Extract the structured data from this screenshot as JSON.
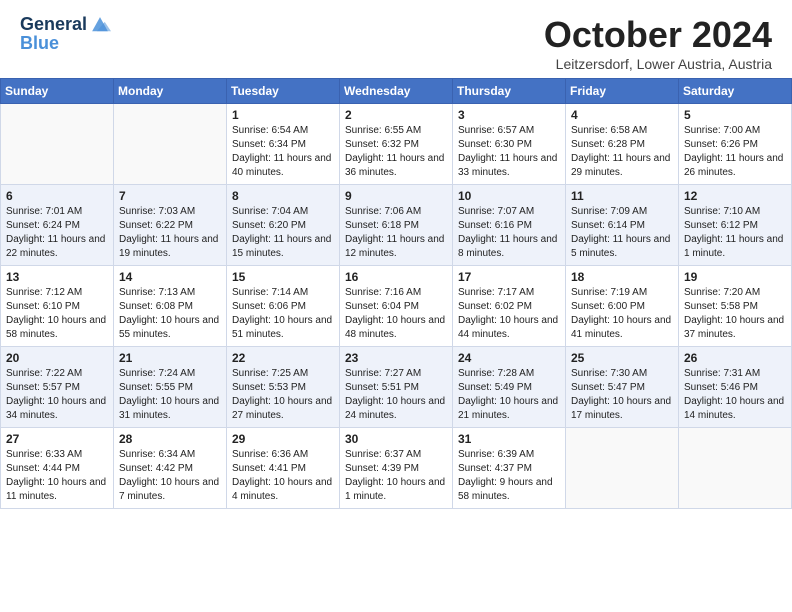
{
  "header": {
    "logo_line1": "General",
    "logo_line2": "Blue",
    "month": "October 2024",
    "location": "Leitzersdorf, Lower Austria, Austria"
  },
  "days_of_week": [
    "Sunday",
    "Monday",
    "Tuesday",
    "Wednesday",
    "Thursday",
    "Friday",
    "Saturday"
  ],
  "weeks": [
    [
      {
        "day": "",
        "info": ""
      },
      {
        "day": "",
        "info": ""
      },
      {
        "day": "1",
        "info": "Sunrise: 6:54 AM\nSunset: 6:34 PM\nDaylight: 11 hours and 40 minutes."
      },
      {
        "day": "2",
        "info": "Sunrise: 6:55 AM\nSunset: 6:32 PM\nDaylight: 11 hours and 36 minutes."
      },
      {
        "day": "3",
        "info": "Sunrise: 6:57 AM\nSunset: 6:30 PM\nDaylight: 11 hours and 33 minutes."
      },
      {
        "day": "4",
        "info": "Sunrise: 6:58 AM\nSunset: 6:28 PM\nDaylight: 11 hours and 29 minutes."
      },
      {
        "day": "5",
        "info": "Sunrise: 7:00 AM\nSunset: 6:26 PM\nDaylight: 11 hours and 26 minutes."
      }
    ],
    [
      {
        "day": "6",
        "info": "Sunrise: 7:01 AM\nSunset: 6:24 PM\nDaylight: 11 hours and 22 minutes."
      },
      {
        "day": "7",
        "info": "Sunrise: 7:03 AM\nSunset: 6:22 PM\nDaylight: 11 hours and 19 minutes."
      },
      {
        "day": "8",
        "info": "Sunrise: 7:04 AM\nSunset: 6:20 PM\nDaylight: 11 hours and 15 minutes."
      },
      {
        "day": "9",
        "info": "Sunrise: 7:06 AM\nSunset: 6:18 PM\nDaylight: 11 hours and 12 minutes."
      },
      {
        "day": "10",
        "info": "Sunrise: 7:07 AM\nSunset: 6:16 PM\nDaylight: 11 hours and 8 minutes."
      },
      {
        "day": "11",
        "info": "Sunrise: 7:09 AM\nSunset: 6:14 PM\nDaylight: 11 hours and 5 minutes."
      },
      {
        "day": "12",
        "info": "Sunrise: 7:10 AM\nSunset: 6:12 PM\nDaylight: 11 hours and 1 minute."
      }
    ],
    [
      {
        "day": "13",
        "info": "Sunrise: 7:12 AM\nSunset: 6:10 PM\nDaylight: 10 hours and 58 minutes."
      },
      {
        "day": "14",
        "info": "Sunrise: 7:13 AM\nSunset: 6:08 PM\nDaylight: 10 hours and 55 minutes."
      },
      {
        "day": "15",
        "info": "Sunrise: 7:14 AM\nSunset: 6:06 PM\nDaylight: 10 hours and 51 minutes."
      },
      {
        "day": "16",
        "info": "Sunrise: 7:16 AM\nSunset: 6:04 PM\nDaylight: 10 hours and 48 minutes."
      },
      {
        "day": "17",
        "info": "Sunrise: 7:17 AM\nSunset: 6:02 PM\nDaylight: 10 hours and 44 minutes."
      },
      {
        "day": "18",
        "info": "Sunrise: 7:19 AM\nSunset: 6:00 PM\nDaylight: 10 hours and 41 minutes."
      },
      {
        "day": "19",
        "info": "Sunrise: 7:20 AM\nSunset: 5:58 PM\nDaylight: 10 hours and 37 minutes."
      }
    ],
    [
      {
        "day": "20",
        "info": "Sunrise: 7:22 AM\nSunset: 5:57 PM\nDaylight: 10 hours and 34 minutes."
      },
      {
        "day": "21",
        "info": "Sunrise: 7:24 AM\nSunset: 5:55 PM\nDaylight: 10 hours and 31 minutes."
      },
      {
        "day": "22",
        "info": "Sunrise: 7:25 AM\nSunset: 5:53 PM\nDaylight: 10 hours and 27 minutes."
      },
      {
        "day": "23",
        "info": "Sunrise: 7:27 AM\nSunset: 5:51 PM\nDaylight: 10 hours and 24 minutes."
      },
      {
        "day": "24",
        "info": "Sunrise: 7:28 AM\nSunset: 5:49 PM\nDaylight: 10 hours and 21 minutes."
      },
      {
        "day": "25",
        "info": "Sunrise: 7:30 AM\nSunset: 5:47 PM\nDaylight: 10 hours and 17 minutes."
      },
      {
        "day": "26",
        "info": "Sunrise: 7:31 AM\nSunset: 5:46 PM\nDaylight: 10 hours and 14 minutes."
      }
    ],
    [
      {
        "day": "27",
        "info": "Sunrise: 6:33 AM\nSunset: 4:44 PM\nDaylight: 10 hours and 11 minutes."
      },
      {
        "day": "28",
        "info": "Sunrise: 6:34 AM\nSunset: 4:42 PM\nDaylight: 10 hours and 7 minutes."
      },
      {
        "day": "29",
        "info": "Sunrise: 6:36 AM\nSunset: 4:41 PM\nDaylight: 10 hours and 4 minutes."
      },
      {
        "day": "30",
        "info": "Sunrise: 6:37 AM\nSunset: 4:39 PM\nDaylight: 10 hours and 1 minute."
      },
      {
        "day": "31",
        "info": "Sunrise: 6:39 AM\nSunset: 4:37 PM\nDaylight: 9 hours and 58 minutes."
      },
      {
        "day": "",
        "info": ""
      },
      {
        "day": "",
        "info": ""
      }
    ]
  ]
}
